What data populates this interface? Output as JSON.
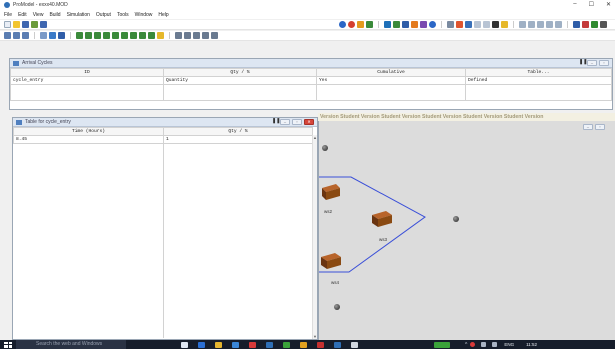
{
  "window": {
    "title": "ProModel - exxx40.MOD",
    "minimize": "–",
    "maximize": "☐",
    "close": "✕"
  },
  "menu": [
    "File",
    "Edit",
    "View",
    "Build",
    "Simulation",
    "Output",
    "Tools",
    "Window",
    "Help"
  ],
  "arrival_window": {
    "title": "Arrival Cycles",
    "columns": [
      "ID",
      "Qty / %",
      "Cumulative",
      "Table..."
    ],
    "rows": [
      [
        "cycle_entry",
        "Quantity",
        "Yes",
        "Defined"
      ]
    ]
  },
  "table_window": {
    "title": "Table for cycle_entry",
    "columns": [
      "Time (Hours)",
      "Qty / %"
    ],
    "rows": [
      [
        "8.45",
        "1"
      ]
    ]
  },
  "layout": {
    "banner": "Version Student Version Student Version Student Version Student Version Student Version",
    "locations": [
      {
        "name": "ws2"
      },
      {
        "name": "ws3"
      },
      {
        "name": "ws4"
      }
    ]
  },
  "taskbar": {
    "search_placeholder": "Search the web and Windows",
    "lang": "ENG",
    "time": "11:52"
  },
  "colors": {
    "accent": "#2f6fb6",
    "taskbar": "#161d2b",
    "path": "#3a4fd8",
    "desk": "#8a4a12"
  }
}
